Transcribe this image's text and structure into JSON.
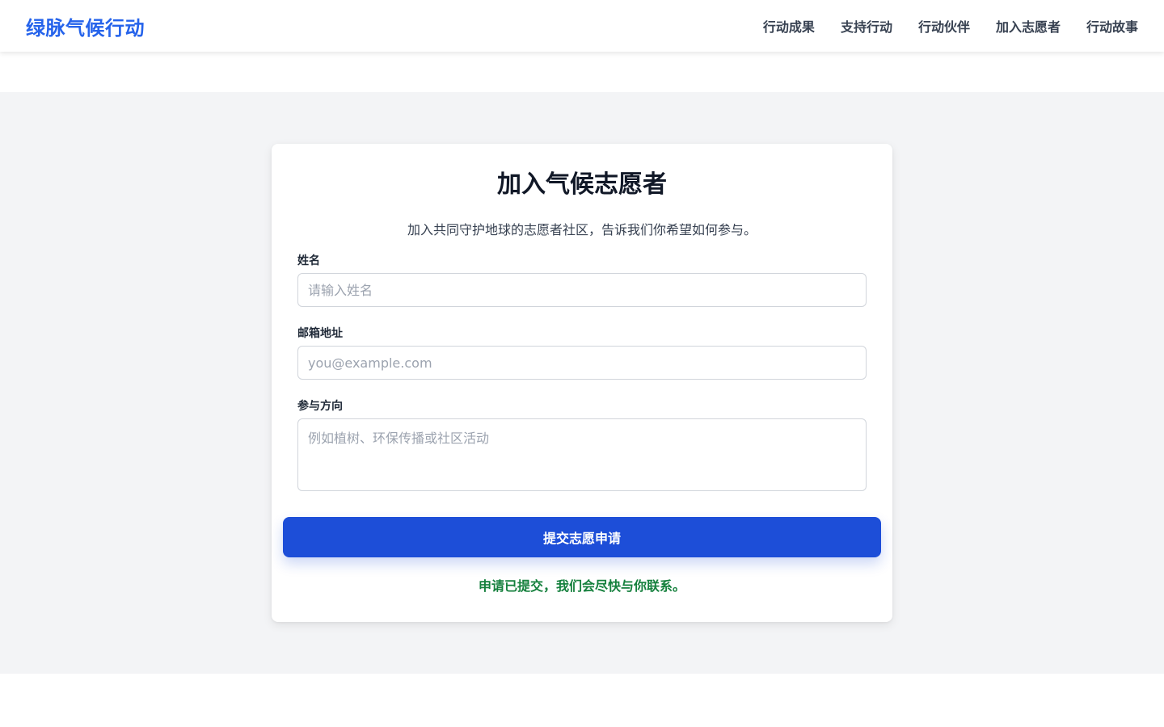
{
  "header": {
    "brand": "绿脉气候行动",
    "nav": [
      {
        "label": "行动成果"
      },
      {
        "label": "支持行动"
      },
      {
        "label": "行动伙伴"
      },
      {
        "label": "加入志愿者"
      },
      {
        "label": "行动故事"
      }
    ]
  },
  "form": {
    "title": "加入气候志愿者",
    "subtitle": "加入共同守护地球的志愿者社区，告诉我们你希望如何参与。",
    "fields": {
      "name": {
        "label": "姓名",
        "placeholder": "请输入姓名",
        "value": ""
      },
      "email": {
        "label": "邮箱地址",
        "placeholder": "you@example.com",
        "value": ""
      },
      "interest": {
        "label": "参与方向",
        "placeholder": "例如植树、环保传播或社区活动",
        "value": ""
      }
    },
    "submit_label": "提交志愿申请",
    "success_message": "申请已提交，我们会尽快与你联系。"
  },
  "colors": {
    "brand": "#2563eb",
    "primary_button": "#1d4ed8",
    "success_text": "#15803d",
    "band_background": "#f3f4f6"
  }
}
